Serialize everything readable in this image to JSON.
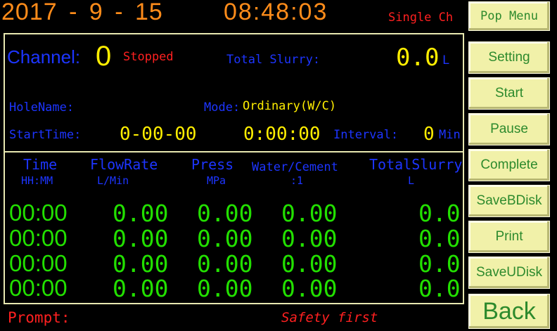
{
  "header": {
    "date": "2017 - 9 - 15",
    "time": "08:48:03",
    "mode_title": "Single Ch"
  },
  "status": {
    "channel_label": "Channel:",
    "channel_value": "0",
    "state": "Stopped",
    "total_slurry_label": "Total Slurry:",
    "total_slurry_value": "0.0",
    "total_slurry_unit": "L",
    "holename_label": "HoleName:",
    "mode_label": "Mode:",
    "mode_value": "Ordinary(W/C)",
    "starttime_label": "StartTime:",
    "starttime_value": "0-00-00",
    "elapsed_value": "0:00:00",
    "interval_label": "Interval:",
    "interval_value": "0",
    "interval_unit": "Min"
  },
  "table": {
    "columns": [
      {
        "name": "Time",
        "unit": "HH:MM"
      },
      {
        "name": "FlowRate",
        "unit": "L/Min"
      },
      {
        "name": "Press",
        "unit": "MPa"
      },
      {
        "name": "Water/Cement",
        "unit": ":1"
      },
      {
        "name": "TotalSlurry",
        "unit": "L"
      }
    ],
    "rows": [
      [
        "00:00",
        "0.00",
        "0.00",
        "0.00",
        "0.0"
      ],
      [
        "00:00",
        "0.00",
        "0.00",
        "0.00",
        "0.0"
      ],
      [
        "00:00",
        "0.00",
        "0.00",
        "0.00",
        "0.0"
      ],
      [
        "00:00",
        "0.00",
        "0.00",
        "0.00",
        "0.0"
      ]
    ]
  },
  "footer": {
    "prompt_label": "Prompt:",
    "prompt_message": "Safety first"
  },
  "buttons": {
    "pop_menu": "Pop Menu",
    "setting": "Setting",
    "start": "Start",
    "pause": "Pause",
    "complete": "Complete",
    "save_bdisk": "SaveBDisk",
    "print": "Print",
    "save_udisk": "SaveUDisk",
    "back": "Back"
  },
  "colors": {
    "background": "#000000",
    "header_text": "#ff8c1a",
    "label_blue": "#1d35ff",
    "value_yellow": "#ffee00",
    "data_green": "#22e000",
    "alert_red": "#ff2020",
    "button_bg": "#f1f1a9",
    "button_text": "#2d8a2d"
  }
}
